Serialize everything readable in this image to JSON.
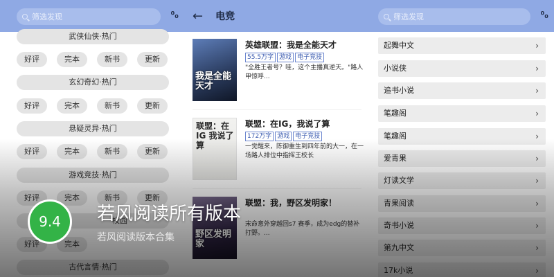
{
  "left": {
    "search_placeholder": "筛选发现",
    "layout_icon": "layout-toggle-icon",
    "layout_glyph": "⁰₀",
    "categories": [
      {
        "head": "武侠仙侠·热门",
        "chips": [
          "好评",
          "完本",
          "新书",
          "更新"
        ]
      },
      {
        "head": "玄幻奇幻·热门",
        "chips": [
          "好评",
          "完本",
          "新书",
          "更新"
        ]
      },
      {
        "head": "悬疑灵异·热门",
        "chips": [
          "好评",
          "完本",
          "新书",
          "更新"
        ]
      },
      {
        "head": "游戏竞技·热门",
        "chips": [
          "好评",
          "完本",
          "新书",
          "更新"
        ]
      },
      {
        "head": "校园",
        "chips": [
          "好评",
          "完本"
        ]
      },
      {
        "head": "古代言情·热门",
        "chips": []
      }
    ]
  },
  "mid": {
    "back_icon": "back-arrow-icon",
    "title": "电竞",
    "books": [
      {
        "cover_text": "我是全能天才",
        "title": "英雄联盟：我是全能天才",
        "tags": [
          "55.5万字",
          "游戏",
          "电子竞技"
        ],
        "desc": "\"全胜王者号？哇，这个主播真逆天。\"路人甲惊呼..."
      },
      {
        "cover_text": "联盟：在IG 我说了算",
        "title": "联盟：在IG，我说了算",
        "tags": [
          "172万字",
          "游戏",
          "电子竞技"
        ],
        "desc": "一觉醒来，陈御重生到四年前的大一，在一场路人排位中指挥王校长"
      },
      {
        "cover_text": "野区发明家",
        "title": "联盟：我，野区发明家！",
        "tags": [],
        "desc": "宋命意外穿越回s7 赛季，成为edg的替补打野。..."
      }
    ]
  },
  "right": {
    "search_placeholder": "筛选发现",
    "sites": [
      "起舞中文",
      "小说侠",
      "追书小说",
      "笔趣阁",
      "笔趣阁",
      "爱青果",
      "灯读文学",
      "青果阅读",
      "奇书小说",
      "第九中文",
      "17k小说"
    ]
  },
  "overlay": {
    "score": "9.4",
    "title": "若风阅读所有版本",
    "subtitle": "若风阅读版本合集"
  },
  "colors": {
    "topbar": "#8fa9e4",
    "score_badge": "#33b347",
    "tag_border": "#6c86cf"
  }
}
